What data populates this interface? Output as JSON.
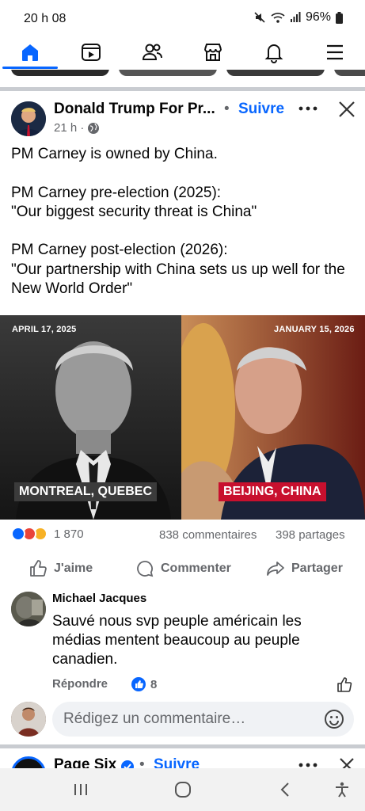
{
  "status_bar": {
    "time": "20 h 08",
    "battery": "96%",
    "icons": [
      "mute-icon",
      "wifi-icon",
      "signal-icon",
      "battery-icon"
    ]
  },
  "navbar": {
    "items": [
      "home-icon",
      "video-icon",
      "friends-icon",
      "marketplace-icon",
      "notifications-icon",
      "menu-icon"
    ],
    "active": "home-icon",
    "accent": "#0866ff"
  },
  "post": {
    "author": "Donald Trump For Pr...",
    "separator": "•",
    "follow_label": "Suivre",
    "time": "21 h ·",
    "privacy_icon": "globe-icon",
    "text_lines": [
      "PM Carney is owned by China.",
      "",
      "PM Carney pre-election (2025):",
      "\"Our biggest security threat is China\"",
      "",
      "PM Carney post-election (2026):",
      "\"Our partnership with China sets us up well for the New World Order\""
    ],
    "image": {
      "left_date": "APRIL 17, 2025",
      "right_date": "JANUARY 15, 2026",
      "left_label": "MONTREAL, QUEBEC",
      "right_label": "BEIJING, CHINA",
      "left_label_color": "#3b3b3b",
      "right_label_color": "#c8102e"
    },
    "reactions_count": "1 870",
    "comments_count": "838 commentaires",
    "shares_count": "398 partages",
    "actions": {
      "like": "J'aime",
      "comment": "Commenter",
      "share": "Partager"
    }
  },
  "comment": {
    "author": "Michael Jacques",
    "text": "Sauvé nous svp peuple américain les médias mentent beaucoup au peuple canadien.",
    "reply_label": "Répondre",
    "likes": "8"
  },
  "comment_input": {
    "placeholder": "Rédigez un commentaire…"
  },
  "next_post": {
    "author": "Page Six",
    "separator": "•",
    "follow_label": "Suivre"
  },
  "system_nav": [
    "recents-icon",
    "home-circle-icon",
    "back-icon",
    "accessibility-icon"
  ]
}
